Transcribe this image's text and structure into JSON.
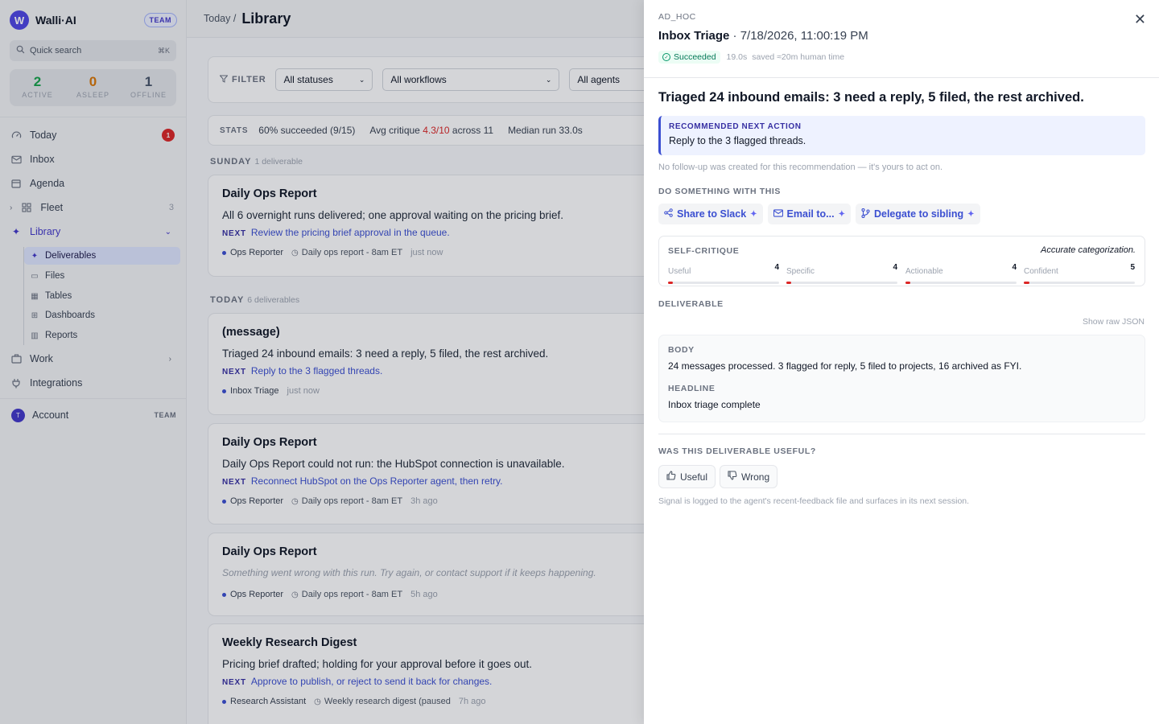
{
  "sidebar": {
    "brand": "Walli·AI",
    "brand_initial": "W",
    "team_badge": "TEAM",
    "search": {
      "placeholder": "Quick search",
      "shortcut": "⌘K"
    },
    "stats": [
      {
        "value": "2",
        "label": "ACTIVE",
        "color": "#16a34a"
      },
      {
        "value": "0",
        "label": "ASLEEP",
        "color": "#d97706"
      },
      {
        "value": "1",
        "label": "OFFLINE",
        "color": "#475569"
      }
    ],
    "nav": {
      "today": {
        "label": "Today",
        "badge": "1"
      },
      "inbox": {
        "label": "Inbox"
      },
      "agenda": {
        "label": "Agenda"
      },
      "fleet": {
        "label": "Fleet",
        "count": "3"
      },
      "library": {
        "label": "Library"
      },
      "work": {
        "label": "Work"
      },
      "integrations": {
        "label": "Integrations"
      }
    },
    "library_sub": [
      "Deliverables",
      "Files",
      "Tables",
      "Dashboards",
      "Reports"
    ],
    "account": {
      "label": "Account",
      "initial": "T",
      "plan": "TEAM"
    }
  },
  "main": {
    "breadcrumb": "Today /",
    "title": "Library",
    "filter": {
      "label": "FILTER",
      "status": "All statuses",
      "workflow": "All workflows",
      "agent": "All agents"
    },
    "stats": {
      "label": "STATS",
      "succeeded": "60% succeeded (9/15)",
      "critique_prefix": "Avg critique",
      "critique_value": "4.3/10",
      "critique_suffix": "across 11",
      "median": "Median run 33.0s"
    },
    "groups": [
      {
        "day": "SUNDAY",
        "count": "1 deliverable"
      },
      {
        "day": "TODAY",
        "count": "6 deliverables"
      }
    ],
    "next_label": "NEXT",
    "cards": [
      {
        "title": "Daily Ops Report",
        "body": "All 6 overnight runs delivered; one approval waiting on the pricing brief.",
        "next": "Review the pricing brief approval in the queue.",
        "agent": "Ops Reporter",
        "schedule": "Daily ops report - 8am ET",
        "time": "just now"
      },
      {
        "title": "(message)",
        "body": "Triaged 24 inbound emails: 3 need a reply, 5 filed, the rest archived.",
        "next": "Reply to the 3 flagged threads.",
        "agent": "Inbox Triage",
        "time": "just now"
      },
      {
        "title": "Daily Ops Report",
        "body": "Daily Ops Report could not run: the HubSpot connection is unavailable.",
        "next": "Reconnect HubSpot on the Ops Reporter agent, then retry.",
        "agent": "Ops Reporter",
        "schedule": "Daily ops report - 8am ET",
        "time": "3h ago"
      },
      {
        "title": "Daily Ops Report",
        "body": "Something went wrong with this run. Try again, or contact support if it keeps happening.",
        "agent": "Ops Reporter",
        "schedule": "Daily ops report - 8am ET",
        "time": "5h ago"
      },
      {
        "title": "Weekly Research Digest",
        "body": "Pricing brief drafted; holding for your approval before it goes out.",
        "next": "Approve to publish, or reject to send it back for changes.",
        "agent": "Research Assistant",
        "schedule": "Weekly research digest (paused",
        "time": "7h ago"
      }
    ]
  },
  "drawer": {
    "kind": "AD_HOC",
    "title": "Inbox Triage",
    "timestamp": "· 7/18/2026, 11:00:19 PM",
    "status": "Succeeded",
    "duration": "19.0s",
    "saved": "saved ≈20m human time",
    "headline": "Triaged 24 inbound emails: 3 need a reply, 5 filed, the rest archived.",
    "recommended": {
      "label": "RECOMMENDED NEXT ACTION",
      "value": "Reply to the 3 flagged threads."
    },
    "rec_note": "No follow-up was created for this recommendation — it's yours to act on.",
    "actions_label": "DO SOMETHING WITH THIS",
    "actions": [
      "Share to Slack",
      "Email to...",
      "Delegate to sibling"
    ],
    "critique": {
      "label": "SELF-CRITIQUE",
      "quote": "Accurate categorization.",
      "metrics": [
        {
          "name": "Useful",
          "value": "4",
          "fraction": 0.04
        },
        {
          "name": "Specific",
          "value": "4",
          "fraction": 0.04
        },
        {
          "name": "Actionable",
          "value": "4",
          "fraction": 0.04
        },
        {
          "name": "Confident",
          "value": "5",
          "fraction": 0.05
        }
      ]
    },
    "deliverable_label": "DELIVERABLE",
    "raw_json": "Show raw JSON",
    "fields": {
      "body_label": "BODY",
      "body": "24 messages processed. 3 flagged for reply, 5 filed to projects, 16 archived as FYI.",
      "headline_label": "HEADLINE",
      "headline": "Inbox triage complete"
    },
    "feedback": {
      "question": "WAS THIS DELIVERABLE USEFUL?",
      "useful": "Useful",
      "wrong": "Wrong",
      "note": "Signal is logged to the agent's recent-feedback file and surfaces in its next session."
    }
  }
}
